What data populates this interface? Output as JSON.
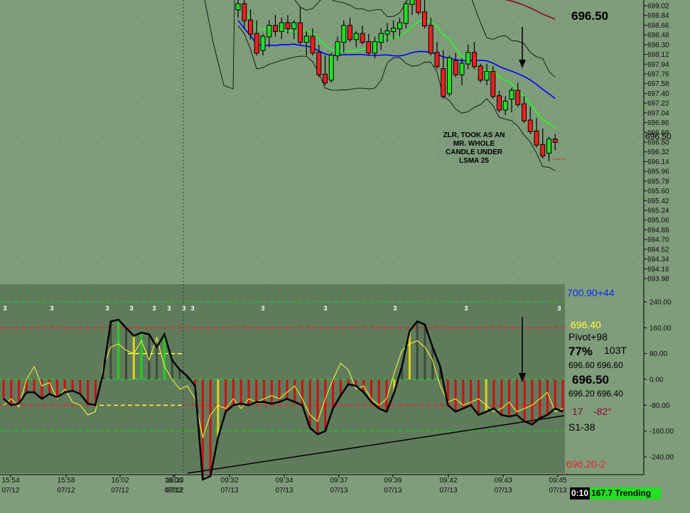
{
  "price_panel": {
    "last_price_label": "696.50",
    "marker_price": "696.50",
    "note_lines": [
      "ZLR, TOOK AS AN",
      "MR. WHOLE",
      "CANDLE UNDER",
      "LSMA 25"
    ],
    "y_ticks": [
      "699.02",
      "698.84",
      "698.66",
      "698.48",
      "698.30",
      "698.12",
      "697.94",
      "697.76",
      "697.58",
      "697.40",
      "697.22",
      "697.04",
      "696.86",
      "696.68",
      "696.50",
      "696.32",
      "696.14",
      "695.96",
      "695.78",
      "695.60",
      "695.42",
      "695.24",
      "695.06",
      "694.88",
      "694.70",
      "694.52",
      "694.34",
      "694.16",
      "693.98"
    ]
  },
  "indicator_panel": {
    "ticks": [
      "240.00",
      "160.00",
      "80.00",
      "0.00",
      "-80.00",
      "-160.00",
      "-240.00"
    ],
    "top_label": "700.90+44",
    "price_yellow": "696.40",
    "pivot": "Pivot+98",
    "pct": "77%",
    "ticks_count": "103T",
    "pair1": "696.60 696.60",
    "big_price": "696.50",
    "pair2": "696.20 696.40",
    "angle_left": "17",
    "angle_right": "-82°",
    "s1": "S1-38",
    "bottom_label": "696.20-2",
    "flag_label": "3"
  },
  "x_axis": {
    "times": [
      "15:54",
      "15:58",
      "16:02",
      "16:06",
      "16:13",
      "09:32",
      "09:34",
      "09:37",
      "09:39",
      "09:42",
      "09:43",
      "09:45"
    ],
    "dates": [
      "07/12",
      "07/12",
      "07/12",
      "07/12",
      "07/12",
      "07/13",
      "07/13",
      "07/13",
      "07/13",
      "07/13",
      "07/13",
      "07/13"
    ]
  },
  "status": {
    "time": "0:10",
    "trend": "167.7 Trending"
  },
  "colors": {
    "background": "#7f9c7b",
    "indicator_bg": "#5f7b5c",
    "up_candle": "#21e121",
    "down_candle": "#ee2020",
    "lsma": "#0000ff",
    "ema": "#20ff20",
    "slow_ma": "#8a0a30"
  },
  "chart_data": [
    {
      "type": "candlestick",
      "y_axis_range": [
        693.98,
        699.02
      ],
      "last_price": 696.5,
      "candles": [
        {
          "o": 698.95,
          "h": 699.3,
          "l": 698.8,
          "c": 699.05
        },
        {
          "o": 699.05,
          "h": 699.3,
          "l": 698.6,
          "c": 698.75
        },
        {
          "o": 698.75,
          "h": 698.95,
          "l": 698.4,
          "c": 698.5
        },
        {
          "o": 698.5,
          "h": 698.75,
          "l": 698.1,
          "c": 698.15
        },
        {
          "o": 698.2,
          "h": 698.5,
          "l": 698.1,
          "c": 698.45
        },
        {
          "o": 698.45,
          "h": 698.75,
          "l": 698.25,
          "c": 698.65
        },
        {
          "o": 698.65,
          "h": 698.85,
          "l": 698.45,
          "c": 698.55
        },
        {
          "o": 698.55,
          "h": 698.8,
          "l": 698.4,
          "c": 698.7
        },
        {
          "o": 698.7,
          "h": 698.85,
          "l": 698.5,
          "c": 698.6
        },
        {
          "o": 698.6,
          "h": 698.75,
          "l": 698.4,
          "c": 698.7
        },
        {
          "o": 698.7,
          "h": 699.0,
          "l": 698.3,
          "c": 698.35
        },
        {
          "o": 698.35,
          "h": 698.55,
          "l": 698.1,
          "c": 698.45
        },
        {
          "o": 698.45,
          "h": 698.6,
          "l": 698.1,
          "c": 698.15
        },
        {
          "o": 698.15,
          "h": 698.3,
          "l": 697.7,
          "c": 697.75
        },
        {
          "o": 697.75,
          "h": 698.1,
          "l": 697.55,
          "c": 697.6
        },
        {
          "o": 697.65,
          "h": 698.15,
          "l": 697.6,
          "c": 698.1
        },
        {
          "o": 698.1,
          "h": 698.45,
          "l": 698.0,
          "c": 698.35
        },
        {
          "o": 698.35,
          "h": 698.75,
          "l": 698.15,
          "c": 698.65
        },
        {
          "o": 698.65,
          "h": 698.8,
          "l": 698.35,
          "c": 698.4
        },
        {
          "o": 698.4,
          "h": 698.55,
          "l": 698.25,
          "c": 698.5
        },
        {
          "o": 698.5,
          "h": 698.65,
          "l": 698.3,
          "c": 698.35
        },
        {
          "o": 698.35,
          "h": 698.5,
          "l": 698.1,
          "c": 698.15
        },
        {
          "o": 698.15,
          "h": 698.45,
          "l": 698.05,
          "c": 698.35
        },
        {
          "o": 698.35,
          "h": 698.6,
          "l": 698.2,
          "c": 698.5
        },
        {
          "o": 698.5,
          "h": 698.7,
          "l": 698.35,
          "c": 698.55
        },
        {
          "o": 698.55,
          "h": 698.75,
          "l": 698.4,
          "c": 698.6
        },
        {
          "o": 698.6,
          "h": 698.8,
          "l": 698.45,
          "c": 698.7
        },
        {
          "o": 698.7,
          "h": 699.1,
          "l": 698.6,
          "c": 699.05
        },
        {
          "o": 699.05,
          "h": 699.25,
          "l": 698.85,
          "c": 699.15
        },
        {
          "o": 699.15,
          "h": 699.3,
          "l": 698.85,
          "c": 698.9
        },
        {
          "o": 698.9,
          "h": 699.2,
          "l": 698.6,
          "c": 698.65
        },
        {
          "o": 698.65,
          "h": 698.8,
          "l": 698.1,
          "c": 698.15
        },
        {
          "o": 698.15,
          "h": 698.35,
          "l": 697.85,
          "c": 697.9
        },
        {
          "o": 697.85,
          "h": 698.2,
          "l": 697.3,
          "c": 697.35
        },
        {
          "o": 697.4,
          "h": 698.1,
          "l": 697.35,
          "c": 698.05
        },
        {
          "o": 698.0,
          "h": 698.15,
          "l": 697.7,
          "c": 697.75
        },
        {
          "o": 697.75,
          "h": 698.05,
          "l": 697.55,
          "c": 697.95
        },
        {
          "o": 697.95,
          "h": 698.3,
          "l": 697.85,
          "c": 698.15
        },
        {
          "o": 698.15,
          "h": 698.35,
          "l": 697.85,
          "c": 697.9
        },
        {
          "o": 697.9,
          "h": 697.95,
          "l": 697.6,
          "c": 697.65
        },
        {
          "o": 697.65,
          "h": 697.95,
          "l": 697.55,
          "c": 697.8
        },
        {
          "o": 697.8,
          "h": 697.9,
          "l": 697.3,
          "c": 697.35
        },
        {
          "o": 697.35,
          "h": 697.45,
          "l": 697.05,
          "c": 697.1
        },
        {
          "o": 697.1,
          "h": 697.35,
          "l": 697.0,
          "c": 697.25
        },
        {
          "o": 697.3,
          "h": 697.5,
          "l": 697.05,
          "c": 697.45
        },
        {
          "o": 697.45,
          "h": 697.6,
          "l": 697.15,
          "c": 697.2
        },
        {
          "o": 697.2,
          "h": 697.35,
          "l": 696.85,
          "c": 696.9
        },
        {
          "o": 696.9,
          "h": 697.15,
          "l": 696.65,
          "c": 696.7
        },
        {
          "o": 696.7,
          "h": 696.95,
          "l": 696.4,
          "c": 696.45
        },
        {
          "o": 696.45,
          "h": 696.75,
          "l": 696.2,
          "c": 696.25
        },
        {
          "o": 696.3,
          "h": 696.6,
          "l": 696.15,
          "c": 696.55
        },
        {
          "o": 696.55,
          "h": 696.65,
          "l": 696.35,
          "c": 696.5
        }
      ]
    },
    {
      "type": "line",
      "y_axis_range": [
        -240,
        240
      ],
      "ticks": [
        240,
        160,
        80,
        0,
        -80,
        -160,
        -240
      ],
      "series": [
        {
          "values": [
            -60,
            -80,
            -75,
            -40,
            -40,
            -60,
            -45,
            -55,
            -40,
            -35,
            -45,
            -75,
            -80,
            20,
            180,
            185,
            160,
            135,
            145,
            140,
            100,
            140,
            60,
            30,
            10,
            -20,
            -310,
            -300,
            -180,
            -100,
            -80,
            -75,
            -80,
            -70,
            -70,
            -75,
            -70,
            -60,
            -70,
            -80,
            -150,
            -170,
            -160,
            -90,
            -50,
            -15,
            -20,
            -40,
            -70,
            -90,
            -100,
            -40,
            40,
            150,
            180,
            170,
            100,
            40,
            -80,
            -100,
            -90,
            -80,
            -110,
            -100,
            -90,
            -110,
            -115,
            -110,
            -130,
            -140,
            -120,
            -110,
            -90,
            -100
          ]
        },
        {
          "values": [
            -80,
            -60,
            -85,
            0,
            40,
            -20,
            -10,
            -60,
            -30,
            -70,
            -80,
            -110,
            -100,
            40,
            100,
            110,
            90,
            80,
            120,
            60,
            130,
            40,
            0,
            -30,
            -20,
            -60,
            -180,
            -110,
            -80,
            -90,
            -60,
            -90,
            -60,
            -70,
            -60,
            -50,
            -60,
            -40,
            -20,
            -60,
            -110,
            -130,
            -60,
            0,
            50,
            30,
            -30,
            -20,
            -60,
            -80,
            -60,
            20,
            90,
            110,
            120,
            100,
            60,
            -20,
            -70,
            -60,
            -80,
            -70,
            -60,
            -80,
            -100,
            -90,
            -70,
            -100,
            -90,
            -80,
            -60,
            -40,
            -100,
            -90
          ]
        },
        {
          "name": "700.90+44",
          "values": []
        }
      ]
    }
  ]
}
